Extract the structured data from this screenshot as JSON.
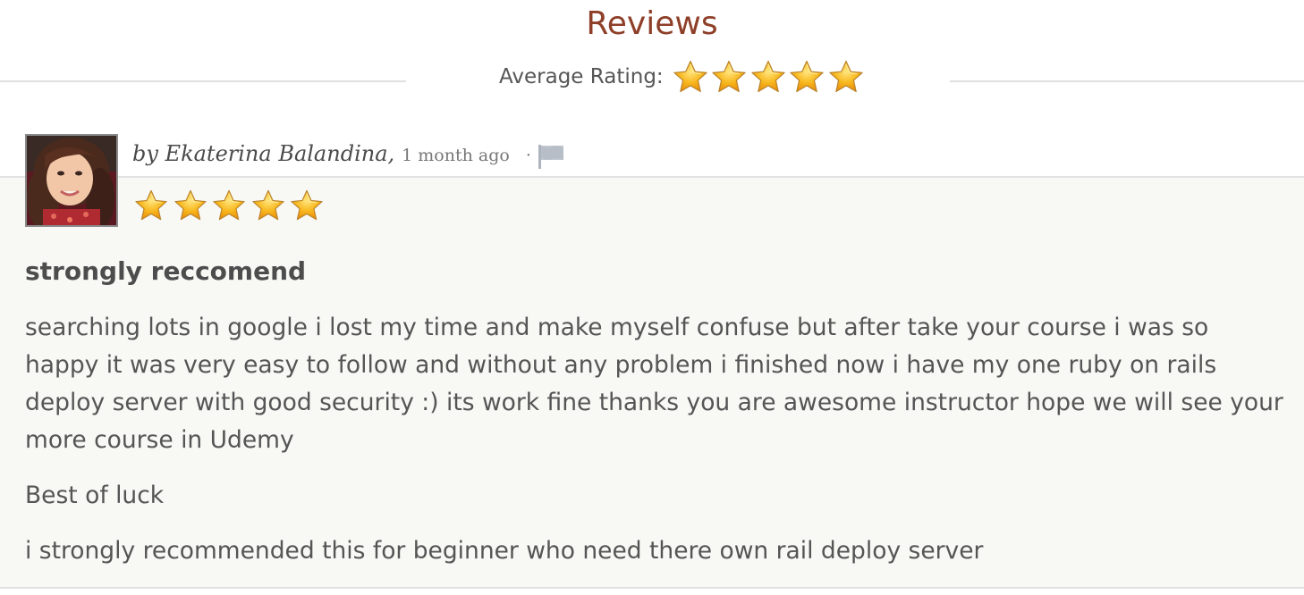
{
  "header": {
    "title": "Reviews",
    "average_rating_label": "Average Rating:",
    "average_rating_stars": 5,
    "average_rating_max": 5
  },
  "review": {
    "author_line": "by Ekaterina Balandina,",
    "time_ago": "1 month ago",
    "separator": "·",
    "rating": 5,
    "rating_max": 5,
    "title": "strongly reccomend",
    "paragraphs": [
      "searching lots in google i lost my time and make myself confuse but after take your course i was so happy it was very easy to follow and without any problem i finished now i have my one ruby on rails deploy server with good security :) its work fine thanks you are awesome instructor hope we will see your more course in Udemy",
      "Best of luck",
      "i strongly recommended this for beginner who need there own rail deploy server"
    ]
  },
  "icons": {
    "star": "star-icon",
    "flag": "flag-icon",
    "avatar": "avatar"
  },
  "colors": {
    "title": "#8e3f28",
    "star_fill": "#f5a818",
    "star_highlight": "#ffd85a",
    "review_background": "#f8f8f4",
    "flag": "#b8bec8"
  }
}
